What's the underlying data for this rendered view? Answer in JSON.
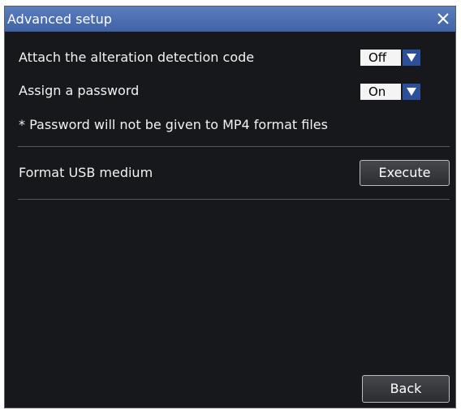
{
  "dialog": {
    "title": "Advanced setup",
    "close_symbol": "×"
  },
  "settings": {
    "alteration": {
      "label": "Attach the alteration detection code",
      "value": "Off"
    },
    "password": {
      "label": "Assign a password",
      "value": "On"
    },
    "note": "* Password will not be given to MP4 format files"
  },
  "format": {
    "label": "Format USB medium",
    "button": "Execute"
  },
  "footer": {
    "back_button": "Back"
  },
  "icons": {
    "close": "close-icon",
    "dropdown": "triangle-down-icon"
  },
  "colors": {
    "title_bar": "#4a6db3",
    "background": "#17181b",
    "dropdown_arrow": "#2c4f9a"
  }
}
